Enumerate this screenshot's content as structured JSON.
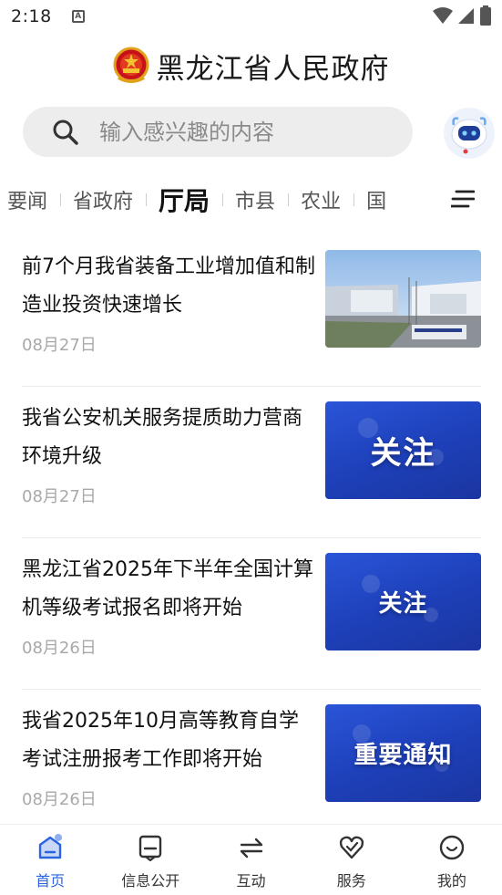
{
  "status_bar": {
    "time": "2:18",
    "notification_icon": "a-icon"
  },
  "header": {
    "title": "黑龙江省人民政府"
  },
  "search": {
    "placeholder": "输入感兴趣的内容"
  },
  "tabs": [
    {
      "label": "要闻"
    },
    {
      "label": "省政府"
    },
    {
      "label": "厅局",
      "active": true
    },
    {
      "label": "市县"
    },
    {
      "label": "农业"
    },
    {
      "label": "国"
    }
  ],
  "news": [
    {
      "title": "前7个月我省装备工业增加值和制造业投资快速增长",
      "date": "08月27日",
      "thumb_type": "photo"
    },
    {
      "title": "我省公安机关服务提质助力营商环境升级",
      "date": "08月27日",
      "thumb_text": "关注"
    },
    {
      "title": "黑龙江省2025年下半年全国计算机等级考试报名即将开始",
      "date": "08月26日",
      "thumb_text": "关注"
    },
    {
      "title": "我省2025年10月高等教育自学考试注册报考工作即将开始",
      "date": "08月26日",
      "thumb_text": "重要通知"
    }
  ],
  "bottom_nav": [
    {
      "label": "首页",
      "icon": "home-icon",
      "active": true
    },
    {
      "label": "信息公开",
      "icon": "info-icon"
    },
    {
      "label": "互动",
      "icon": "interact-icon"
    },
    {
      "label": "服务",
      "icon": "service-icon"
    },
    {
      "label": "我的",
      "icon": "profile-icon"
    }
  ],
  "colors": {
    "accent": "#2a64e0",
    "thumb_blue": "#1d3fb8"
  }
}
